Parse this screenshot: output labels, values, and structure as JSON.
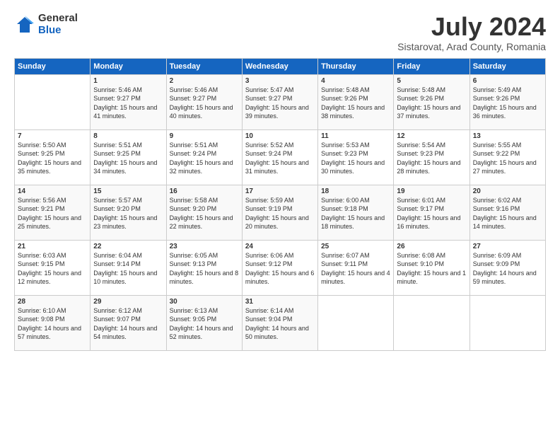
{
  "logo": {
    "general": "General",
    "blue": "Blue"
  },
  "title": "July 2024",
  "subtitle": "Sistarovat, Arad County, Romania",
  "days_of_week": [
    "Sunday",
    "Monday",
    "Tuesday",
    "Wednesday",
    "Thursday",
    "Friday",
    "Saturday"
  ],
  "weeks": [
    [
      {
        "day": "",
        "sunrise": "",
        "sunset": "",
        "daylight": ""
      },
      {
        "day": "1",
        "sunrise": "Sunrise: 5:46 AM",
        "sunset": "Sunset: 9:27 PM",
        "daylight": "Daylight: 15 hours and 41 minutes."
      },
      {
        "day": "2",
        "sunrise": "Sunrise: 5:46 AM",
        "sunset": "Sunset: 9:27 PM",
        "daylight": "Daylight: 15 hours and 40 minutes."
      },
      {
        "day": "3",
        "sunrise": "Sunrise: 5:47 AM",
        "sunset": "Sunset: 9:27 PM",
        "daylight": "Daylight: 15 hours and 39 minutes."
      },
      {
        "day": "4",
        "sunrise": "Sunrise: 5:48 AM",
        "sunset": "Sunset: 9:26 PM",
        "daylight": "Daylight: 15 hours and 38 minutes."
      },
      {
        "day": "5",
        "sunrise": "Sunrise: 5:48 AM",
        "sunset": "Sunset: 9:26 PM",
        "daylight": "Daylight: 15 hours and 37 minutes."
      },
      {
        "day": "6",
        "sunrise": "Sunrise: 5:49 AM",
        "sunset": "Sunset: 9:26 PM",
        "daylight": "Daylight: 15 hours and 36 minutes."
      }
    ],
    [
      {
        "day": "7",
        "sunrise": "Sunrise: 5:50 AM",
        "sunset": "Sunset: 9:25 PM",
        "daylight": "Daylight: 15 hours and 35 minutes."
      },
      {
        "day": "8",
        "sunrise": "Sunrise: 5:51 AM",
        "sunset": "Sunset: 9:25 PM",
        "daylight": "Daylight: 15 hours and 34 minutes."
      },
      {
        "day": "9",
        "sunrise": "Sunrise: 5:51 AM",
        "sunset": "Sunset: 9:24 PM",
        "daylight": "Daylight: 15 hours and 32 minutes."
      },
      {
        "day": "10",
        "sunrise": "Sunrise: 5:52 AM",
        "sunset": "Sunset: 9:24 PM",
        "daylight": "Daylight: 15 hours and 31 minutes."
      },
      {
        "day": "11",
        "sunrise": "Sunrise: 5:53 AM",
        "sunset": "Sunset: 9:23 PM",
        "daylight": "Daylight: 15 hours and 30 minutes."
      },
      {
        "day": "12",
        "sunrise": "Sunrise: 5:54 AM",
        "sunset": "Sunset: 9:23 PM",
        "daylight": "Daylight: 15 hours and 28 minutes."
      },
      {
        "day": "13",
        "sunrise": "Sunrise: 5:55 AM",
        "sunset": "Sunset: 9:22 PM",
        "daylight": "Daylight: 15 hours and 27 minutes."
      }
    ],
    [
      {
        "day": "14",
        "sunrise": "Sunrise: 5:56 AM",
        "sunset": "Sunset: 9:21 PM",
        "daylight": "Daylight: 15 hours and 25 minutes."
      },
      {
        "day": "15",
        "sunrise": "Sunrise: 5:57 AM",
        "sunset": "Sunset: 9:20 PM",
        "daylight": "Daylight: 15 hours and 23 minutes."
      },
      {
        "day": "16",
        "sunrise": "Sunrise: 5:58 AM",
        "sunset": "Sunset: 9:20 PM",
        "daylight": "Daylight: 15 hours and 22 minutes."
      },
      {
        "day": "17",
        "sunrise": "Sunrise: 5:59 AM",
        "sunset": "Sunset: 9:19 PM",
        "daylight": "Daylight: 15 hours and 20 minutes."
      },
      {
        "day": "18",
        "sunrise": "Sunrise: 6:00 AM",
        "sunset": "Sunset: 9:18 PM",
        "daylight": "Daylight: 15 hours and 18 minutes."
      },
      {
        "day": "19",
        "sunrise": "Sunrise: 6:01 AM",
        "sunset": "Sunset: 9:17 PM",
        "daylight": "Daylight: 15 hours and 16 minutes."
      },
      {
        "day": "20",
        "sunrise": "Sunrise: 6:02 AM",
        "sunset": "Sunset: 9:16 PM",
        "daylight": "Daylight: 15 hours and 14 minutes."
      }
    ],
    [
      {
        "day": "21",
        "sunrise": "Sunrise: 6:03 AM",
        "sunset": "Sunset: 9:15 PM",
        "daylight": "Daylight: 15 hours and 12 minutes."
      },
      {
        "day": "22",
        "sunrise": "Sunrise: 6:04 AM",
        "sunset": "Sunset: 9:14 PM",
        "daylight": "Daylight: 15 hours and 10 minutes."
      },
      {
        "day": "23",
        "sunrise": "Sunrise: 6:05 AM",
        "sunset": "Sunset: 9:13 PM",
        "daylight": "Daylight: 15 hours and 8 minutes."
      },
      {
        "day": "24",
        "sunrise": "Sunrise: 6:06 AM",
        "sunset": "Sunset: 9:12 PM",
        "daylight": "Daylight: 15 hours and 6 minutes."
      },
      {
        "day": "25",
        "sunrise": "Sunrise: 6:07 AM",
        "sunset": "Sunset: 9:11 PM",
        "daylight": "Daylight: 15 hours and 4 minutes."
      },
      {
        "day": "26",
        "sunrise": "Sunrise: 6:08 AM",
        "sunset": "Sunset: 9:10 PM",
        "daylight": "Daylight: 15 hours and 1 minute."
      },
      {
        "day": "27",
        "sunrise": "Sunrise: 6:09 AM",
        "sunset": "Sunset: 9:09 PM",
        "daylight": "Daylight: 14 hours and 59 minutes."
      }
    ],
    [
      {
        "day": "28",
        "sunrise": "Sunrise: 6:10 AM",
        "sunset": "Sunset: 9:08 PM",
        "daylight": "Daylight: 14 hours and 57 minutes."
      },
      {
        "day": "29",
        "sunrise": "Sunrise: 6:12 AM",
        "sunset": "Sunset: 9:07 PM",
        "daylight": "Daylight: 14 hours and 54 minutes."
      },
      {
        "day": "30",
        "sunrise": "Sunrise: 6:13 AM",
        "sunset": "Sunset: 9:05 PM",
        "daylight": "Daylight: 14 hours and 52 minutes."
      },
      {
        "day": "31",
        "sunrise": "Sunrise: 6:14 AM",
        "sunset": "Sunset: 9:04 PM",
        "daylight": "Daylight: 14 hours and 50 minutes."
      },
      {
        "day": "",
        "sunrise": "",
        "sunset": "",
        "daylight": ""
      },
      {
        "day": "",
        "sunrise": "",
        "sunset": "",
        "daylight": ""
      },
      {
        "day": "",
        "sunrise": "",
        "sunset": "",
        "daylight": ""
      }
    ]
  ]
}
